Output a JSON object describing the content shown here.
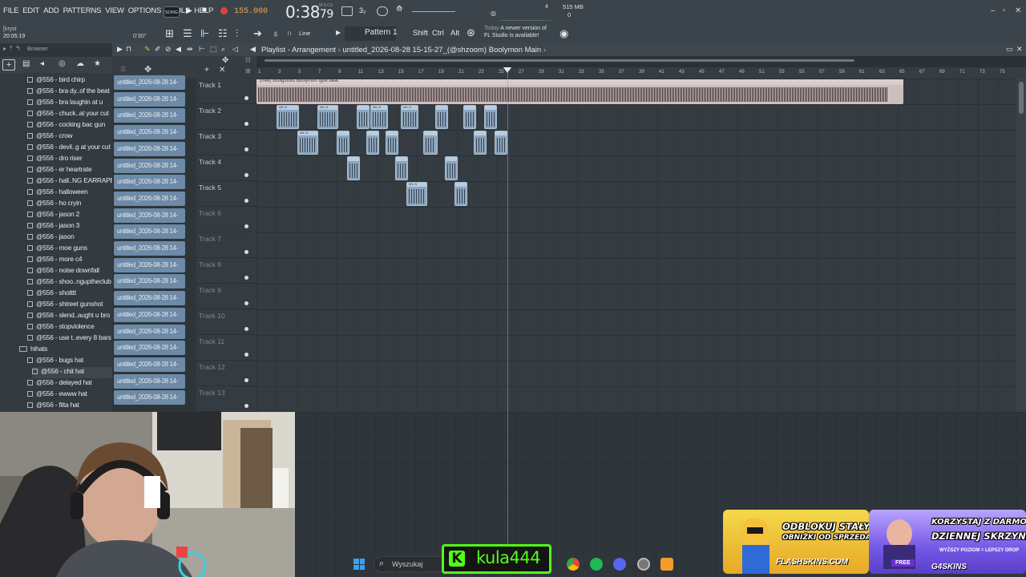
{
  "menu": [
    "FILE",
    "EDIT",
    "ADD",
    "PATTERNS",
    "VIEW",
    "OPTIONS",
    "TOOLS",
    "HELP"
  ],
  "transport": {
    "mode_badge": "SONG",
    "tempo": "155.000",
    "time": "0:38",
    "time_sub": "79",
    "time_unit": "M:S:CS",
    "cpu_value": "4",
    "memory": "515 MB",
    "memory_sub": "0"
  },
  "info": {
    "user": "[kryst",
    "clock": "20:05:19",
    "angle": "0'30\""
  },
  "toolbar": {
    "snap": "Line",
    "pattern": "Pattern 1",
    "modifiers": [
      "Shift",
      "Ctrl",
      "Alt"
    ],
    "news_today": "Today",
    "news_line1": "A newer version of",
    "news_line2": "FL Studio is available!"
  },
  "browser": {
    "title": "Browser",
    "items": [
      {
        "label": "@556 - bird chirp",
        "type": "file"
      },
      {
        "label": "@556 - bra dy..of the beat",
        "type": "file"
      },
      {
        "label": "@556 - bra laughin at u",
        "type": "file"
      },
      {
        "label": "@556 - chuck..at your cut",
        "type": "file"
      },
      {
        "label": "@556 - cocking bac gun",
        "type": "file"
      },
      {
        "label": "@556 - crow",
        "type": "file"
      },
      {
        "label": "@556 - devil..g at your cut",
        "type": "file"
      },
      {
        "label": "@556 - dro riser",
        "type": "file"
      },
      {
        "label": "@556 - er heartrate",
        "type": "file"
      },
      {
        "label": "@556 - hall..NG EARRAPE)",
        "type": "file"
      },
      {
        "label": "@556 - halloween",
        "type": "file"
      },
      {
        "label": "@556 - ho cryin",
        "type": "file"
      },
      {
        "label": "@556 - jason 2",
        "type": "file"
      },
      {
        "label": "@556 - jason 3",
        "type": "file"
      },
      {
        "label": "@556 - jason",
        "type": "file"
      },
      {
        "label": "@556 - moe guns",
        "type": "file"
      },
      {
        "label": "@556 - more c4",
        "type": "file"
      },
      {
        "label": "@556 - noise downfall",
        "type": "file"
      },
      {
        "label": "@556 - shoo..nguptheclub",
        "type": "file"
      },
      {
        "label": "@556 - shotttt",
        "type": "file"
      },
      {
        "label": "@556 - shtreet gunshot",
        "type": "file"
      },
      {
        "label": "@556 - slend..aught u bro",
        "type": "file"
      },
      {
        "label": "@556 - stopviolence",
        "type": "file"
      },
      {
        "label": "@556 - use t..every 8 bars",
        "type": "file"
      },
      {
        "label": "hihats",
        "type": "folder"
      },
      {
        "label": "@556 - bugs hat",
        "type": "file"
      },
      {
        "label": "@556 - chit hat",
        "type": "file"
      },
      {
        "label": "@556 - delayed hat",
        "type": "file"
      },
      {
        "label": "@556 - ewww hat",
        "type": "file"
      },
      {
        "label": "@556 - filta hat",
        "type": "file"
      }
    ]
  },
  "playlist": {
    "title": "Playlist - Arrangement",
    "breadcrumb": "untitled_2026-08-28 15-15-27_(@shzoom) Boolymon Main",
    "pattern_label": "untitled_2026-08-28 14-",
    "pattern_count": 20,
    "ruler": [
      "1",
      "3",
      "5",
      "7",
      "9",
      "11",
      "13",
      "15",
      "17",
      "19",
      "21",
      "23",
      "25",
      "27",
      "29",
      "31",
      "33",
      "35",
      "37",
      "39",
      "41",
      "43",
      "45",
      "47",
      "49",
      "51",
      "53",
      "55",
      "57",
      "59",
      "61",
      "63",
      "65",
      "67",
      "69",
      "71",
      "73",
      "75"
    ],
    "tracks": [
      "Track 1",
      "Track 2",
      "Track 3",
      "Track 4",
      "Track 5",
      "Track 6",
      "Track 7",
      "Track 8",
      "Track 9",
      "Track 10",
      "Track 11",
      "Track 12",
      "Track 13"
    ],
    "beat_clip_label": "(free) xoolglocks boolymon type beat",
    "short_clip_label": "un..n"
  },
  "taskbar": {
    "search_placeholder": "Wyszukaj"
  },
  "kick": {
    "logo": "K",
    "username": "kula444"
  },
  "ads": {
    "ad1_line1": "ODBLOKUJ STAŁY %",
    "ad1_line2": "OBNIŻKI OD SPRZEDAŻY",
    "ad1_brand": "FLASHSKINS.COM",
    "ad2_line1": "KORZYSTAJ Z DARMOWEJ",
    "ad2_line2": "DZIENNEJ SKRZYNKI!",
    "ad2_sub": "WYŻSZY POZIOM = LEPSZY DROP",
    "ad2_free": "FREE",
    "ad2_brand": "G4SKINS"
  }
}
